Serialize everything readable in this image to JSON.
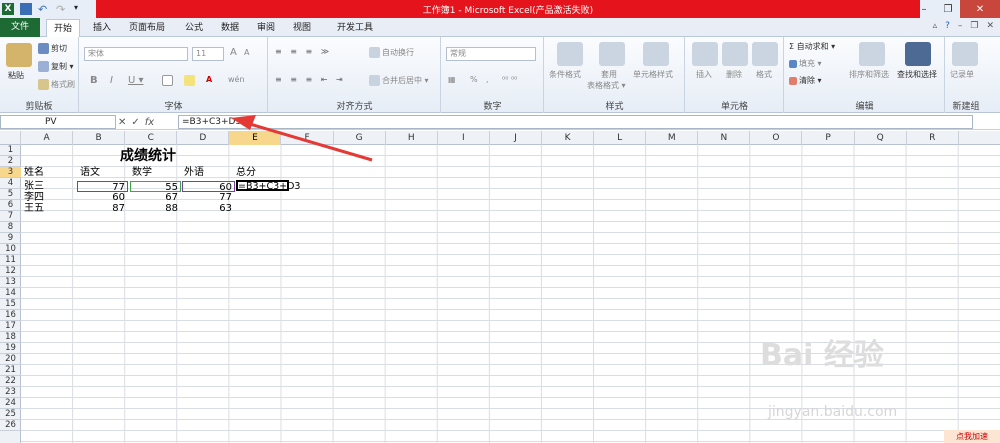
{
  "window": {
    "title": "工作簿1 - Microsoft Excel(产品激活失败)"
  },
  "ribbon_tabs": [
    "文件",
    "开始",
    "插入",
    "页面布局",
    "公式",
    "数据",
    "审阅",
    "视图",
    "开发工具"
  ],
  "clipboard": {
    "paste": "粘贴",
    "cut": "剪切",
    "copy": "复制 ▾",
    "format_painter": "格式刷",
    "label": "剪贴板"
  },
  "font": {
    "name": "宋体",
    "size": "11",
    "bold": "B",
    "italic": "I",
    "underline": "U ▾",
    "grow": "A",
    "shrink": "A",
    "wen": "wén",
    "label": "字体"
  },
  "alignment": {
    "wrap": "自动换行",
    "merge": "合并后居中 ▾",
    "label": "对齐方式"
  },
  "number": {
    "format": "常规",
    "pct": "%",
    "comma": ",",
    "label": "数字"
  },
  "styles": {
    "cond": "条件格式",
    "table": "套用",
    "table2": "表格格式 ▾",
    "cell": "单元格样式",
    "label": "样式"
  },
  "cells": {
    "insert": "插入",
    "delete": "删除",
    "format": "格式",
    "label": "单元格"
  },
  "editing": {
    "autosum": "Σ 自动求和 ▾",
    "fill": "填充 ▾",
    "clear": "清除 ▾",
    "sort": "排序和筛选",
    "find": "查找和选择",
    "label": "编辑"
  },
  "newgroup": {
    "item": "记录单",
    "label": "新建组"
  },
  "formula_bar": {
    "name_box": "PV",
    "formula": "=B3+C3+D3",
    "fx": "fx"
  },
  "columns": [
    "A",
    "B",
    "C",
    "D",
    "E",
    "F",
    "G",
    "H",
    "I",
    "J",
    "K",
    "L",
    "M",
    "N",
    "O",
    "P",
    "Q",
    "R"
  ],
  "selected_column": "E",
  "rows": [
    "1",
    "2",
    "3",
    "4",
    "5",
    "6",
    "7",
    "8",
    "9",
    "10",
    "11",
    "12",
    "13",
    "14",
    "15",
    "16",
    "17",
    "18",
    "19",
    "20",
    "21",
    "22",
    "23",
    "24",
    "25",
    "26"
  ],
  "selected_row": "3",
  "sheet": {
    "title": "成绩统计",
    "headers": [
      "姓名",
      "语文",
      "数学",
      "外语",
      "总分"
    ],
    "data": [
      {
        "name": "张三",
        "chinese": "77",
        "math": "55",
        "english": "60",
        "total": "=B3+C3+D3"
      },
      {
        "name": "李四",
        "chinese": "60",
        "math": "67",
        "english": "77",
        "total": ""
      },
      {
        "name": "王五",
        "chinese": "87",
        "math": "88",
        "english": "63",
        "total": ""
      }
    ]
  },
  "watermark": {
    "text": "Bai 经验",
    "url": "jingyan.baidu.com",
    "badge": "点我加速"
  },
  "colors": {
    "file_tab": "#1d6a35",
    "title_red": "#e5141c",
    "selection": "#f7d78b",
    "arrow": "#e53935"
  }
}
